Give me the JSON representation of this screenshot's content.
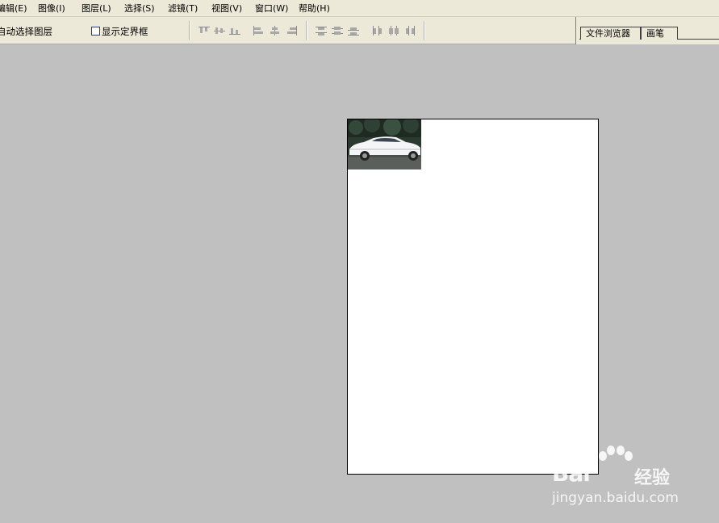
{
  "menubar": {
    "items": [
      {
        "label": "编辑(E)"
      },
      {
        "label": "图像(I)"
      },
      {
        "label": "图层(L)"
      },
      {
        "label": "选择(S)"
      },
      {
        "label": "滤镜(T)"
      },
      {
        "label": "视图(V)"
      },
      {
        "label": "窗口(W)"
      },
      {
        "label": "帮助(H)"
      }
    ]
  },
  "options": {
    "auto_select_label": "自动选择图层",
    "show_bounds_label": "显示定界框",
    "show_bounds_checked": false
  },
  "palette_well": {
    "tabs": [
      {
        "label": "文件浏览器"
      },
      {
        "label": "画笔"
      }
    ]
  },
  "watermark": {
    "brand": "Bai",
    "brand_suffix": "经验",
    "url": "jingyan.baidu.com"
  },
  "colors": {
    "chrome": "#ece9d8",
    "workspace": "#c0c0c0",
    "canvas": "#ffffff"
  }
}
